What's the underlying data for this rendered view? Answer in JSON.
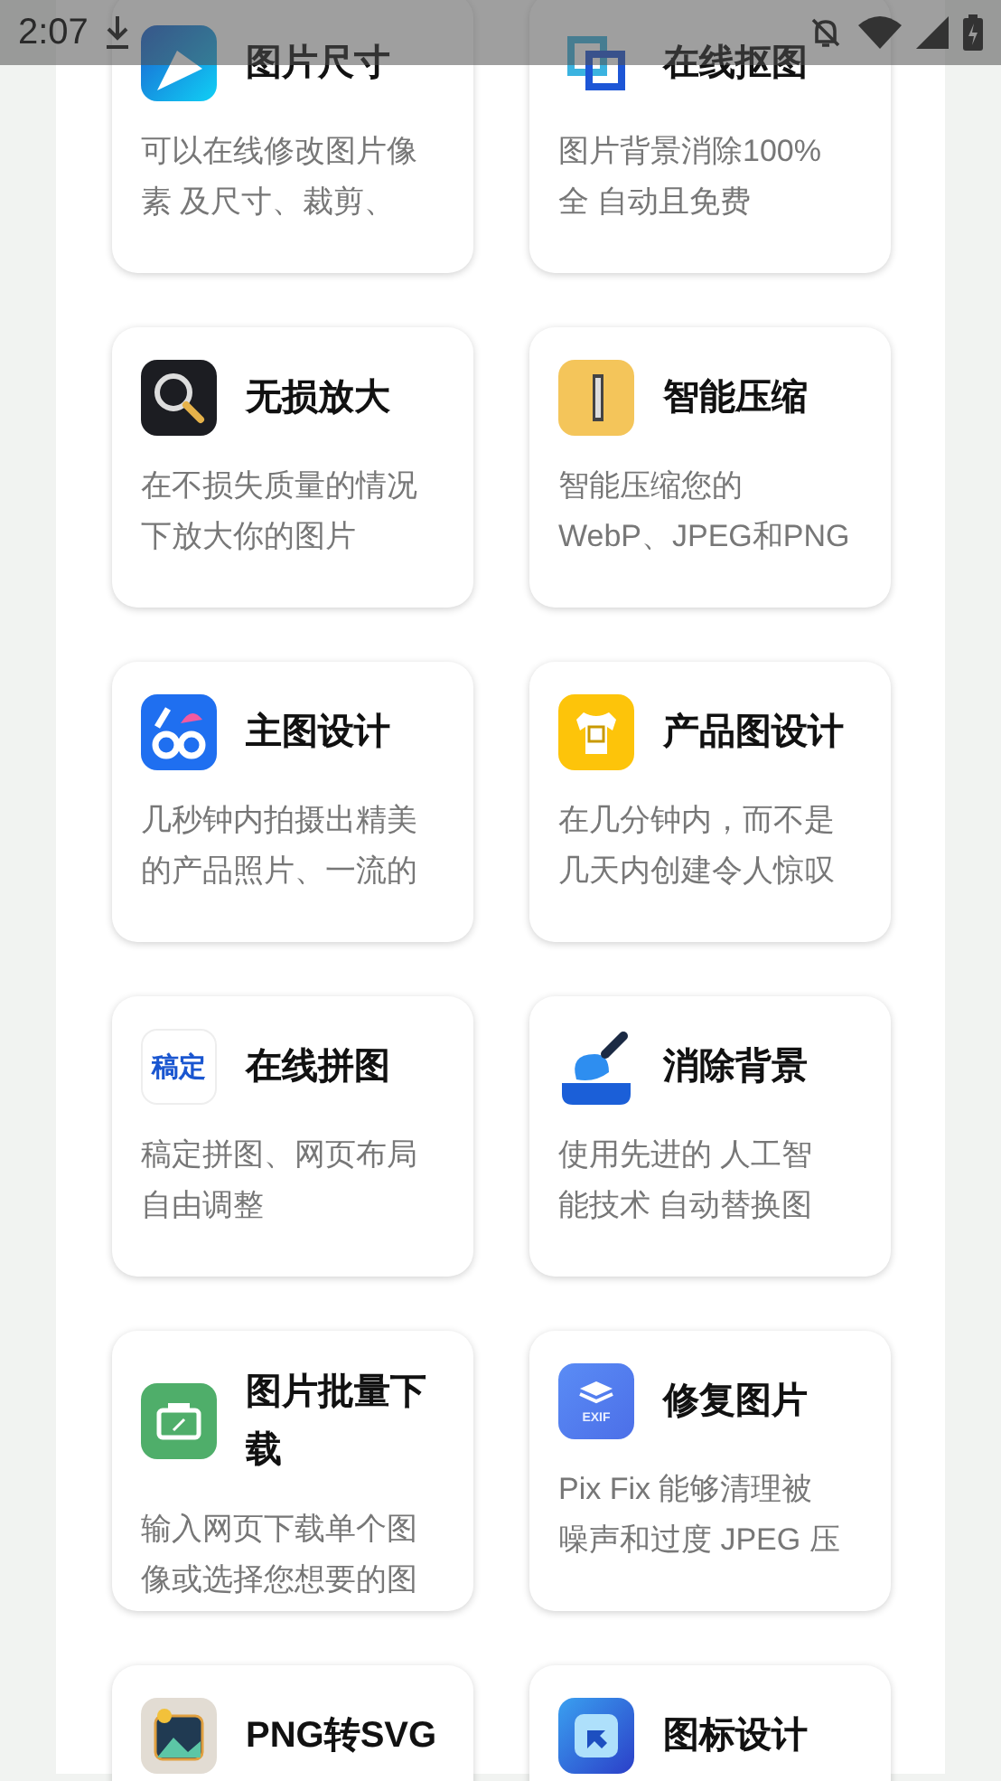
{
  "status_bar": {
    "time": "2:07"
  },
  "tools": [
    {
      "title": "图片尺寸",
      "description_lines": [
        "可以在线修改图片像",
        "素 及尺寸、裁剪、"
      ]
    },
    {
      "title": "在线抠图",
      "description_lines": [
        "图片背景消除100%",
        "全 自动且免费"
      ]
    },
    {
      "title": "无损放大",
      "description_lines": [
        "在不损失质量的情况",
        "下放大你的图片"
      ]
    },
    {
      "title": "智能压缩",
      "description_lines": [
        "智能压缩您的",
        "WebP、JPEG和PNG"
      ]
    },
    {
      "title": "主图设计",
      "description_lines": [
        "几秒钟内拍摄出精美",
        "的产品照片、一流的"
      ]
    },
    {
      "title": "产品图设计",
      "description_lines": [
        "在几分钟内，而不是",
        "几天内创建令人惊叹"
      ]
    },
    {
      "title": "在线拼图",
      "logo_text": "稿定",
      "description_lines": [
        "稿定拼图、网页布局",
        "自由调整"
      ]
    },
    {
      "title": "消除背景",
      "description_lines": [
        "使用先进的 人工智",
        "能技术 自动替换图"
      ]
    },
    {
      "title": "图片批量下载",
      "description_lines": [
        "输入网页下载单个图",
        "像或选择您想要的图"
      ]
    },
    {
      "title": "修复图片",
      "logo_text": "EXIF",
      "description_lines": [
        "Pix Fix 能够清理被",
        "噪声和过度 JPEG 压"
      ]
    },
    {
      "title": "PNG转SVG"
    },
    {
      "title": "图标设计"
    }
  ]
}
